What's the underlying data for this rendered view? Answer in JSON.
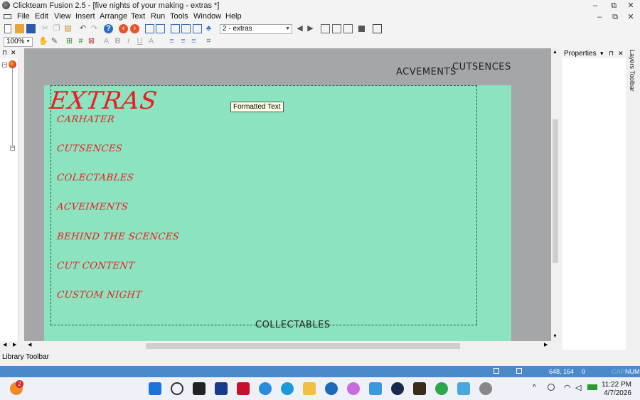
{
  "window": {
    "title": "Clickteam Fusion 2.5 - [five nights of your making  - extras *]",
    "controls": [
      "–",
      "⧉",
      "✕"
    ]
  },
  "menubar": {
    "items": [
      "File",
      "Edit",
      "View",
      "Insert",
      "Arrange",
      "Text",
      "Run",
      "Tools",
      "Window",
      "Help"
    ],
    "right_controls": [
      "–",
      "⧉",
      "✕"
    ]
  },
  "toolbar": {
    "frame_select": "2 - extras",
    "zoom_select": "100%"
  },
  "panels": {
    "left_pin": "⊓",
    "left_close": "✕",
    "properties_title": "Properties",
    "properties_controls": [
      "▾",
      "⊓",
      "✕"
    ],
    "layers_toolbar": "Layers Toolbar",
    "library_toolbar": "Library Toolbar"
  },
  "frame": {
    "title": "EXTRAS",
    "menu_items": [
      "CARHATER",
      "CUTSENCES",
      "COLECTABLES",
      "ACVEIMENTS",
      "BEHIND THE SCENCES",
      "CUT CONTENT",
      "CUSTOM NIGHT"
    ],
    "tooltip": "Formatted Text",
    "outside_labels": {
      "top_left": "ACVEMENTS",
      "top_right": "CUTSENCES",
      "bottom": "COLLECTABLES"
    },
    "colors": {
      "background": "#8be3bf",
      "text": "#ee1c24",
      "workspace": "#a5a6a7"
    }
  },
  "statusbar": {
    "coords": "648, 164",
    "count": "0",
    "cap": "CAP",
    "num": "NUM"
  },
  "taskbar": {
    "notif_badge": "2",
    "time": "11:22 PM",
    "date": "4/7/2026"
  }
}
